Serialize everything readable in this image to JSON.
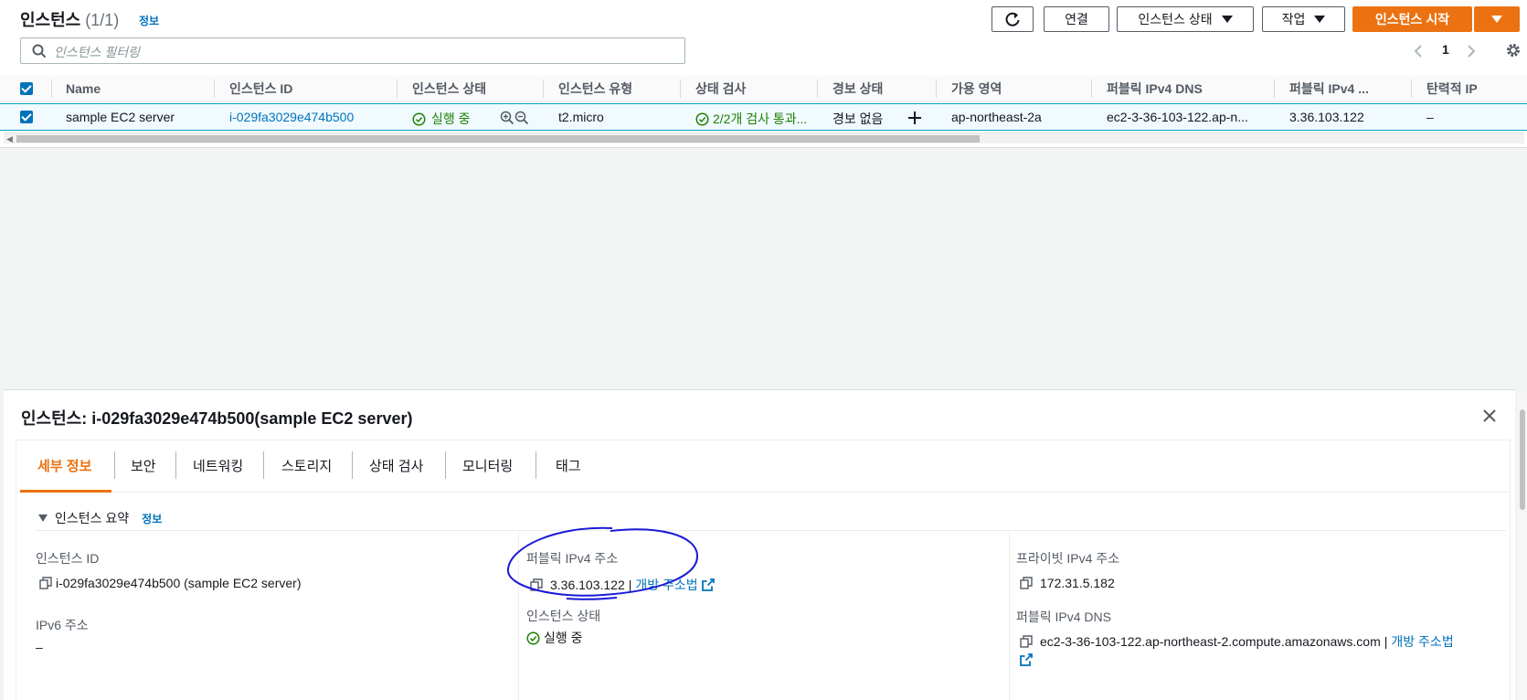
{
  "header": {
    "title": "인스턴스",
    "count": "(1/1)",
    "info_link": "정보"
  },
  "toolbar": {
    "refresh_icon": "refresh-icon",
    "connect_label": "연결",
    "instance_state_label": "인스턴스 상태",
    "actions_label": "작업",
    "launch_label": "인스턴스 시작"
  },
  "search": {
    "placeholder": "인스턴스 필터링"
  },
  "pager": {
    "page": "1"
  },
  "table": {
    "columns": [
      "Name",
      "인스턴스 ID",
      "인스턴스 상태",
      "인스턴스 유형",
      "상태 검사",
      "경보 상태",
      "가용 영역",
      "퍼블릭 IPv4 DNS",
      "퍼블릭 IPv4 ...",
      "탄력적 IP"
    ],
    "rows": [
      {
        "name": "sample EC2 server",
        "instance_id": "i-029fa3029e474b500",
        "state": "실행 중",
        "type": "t2.micro",
        "status_check": "2/2개 검사 통과...",
        "alarm": "경보 없음",
        "az": "ap-northeast-2a",
        "public_dns": "ec2-3-36-103-122.ap-n...",
        "public_ip": "3.36.103.122",
        "elastic_ip": "–"
      }
    ]
  },
  "details": {
    "panel_title": "인스턴스: i-029fa3029e474b500(sample EC2 server)",
    "tabs": [
      "세부 정보",
      "보안",
      "네트워킹",
      "스토리지",
      "상태 검사",
      "모니터링",
      "태그"
    ],
    "summary_title": "인스턴스 요약",
    "summary_info": "정보",
    "instance_id_label": "인스턴스 ID",
    "instance_id_value": "i-029fa3029e474b500 (sample EC2 server)",
    "public_ip_label": "퍼블릭 IPv4 주소",
    "public_ip_value": "3.36.103.122",
    "separator": "|",
    "open_address": "개방 주소법",
    "private_ip_label": "프라이빗 IPv4 주소",
    "private_ip_value": "172.31.5.182",
    "ipv6_label": "IPv6 주소",
    "ipv6_value": "–",
    "state_label": "인스턴스 상태",
    "state_value": "실행 중",
    "public_dns_label": "퍼블릭 IPv4 DNS",
    "public_dns_value": "ec2-3-36-103-122.ap-northeast-2.compute.amazonaws.com",
    "open_address_2": "개방 주소법"
  },
  "colors": {
    "accent": "#ec7211",
    "link": "#0073bb",
    "success": "#1d8102",
    "annotation": "#1a1ad6"
  }
}
